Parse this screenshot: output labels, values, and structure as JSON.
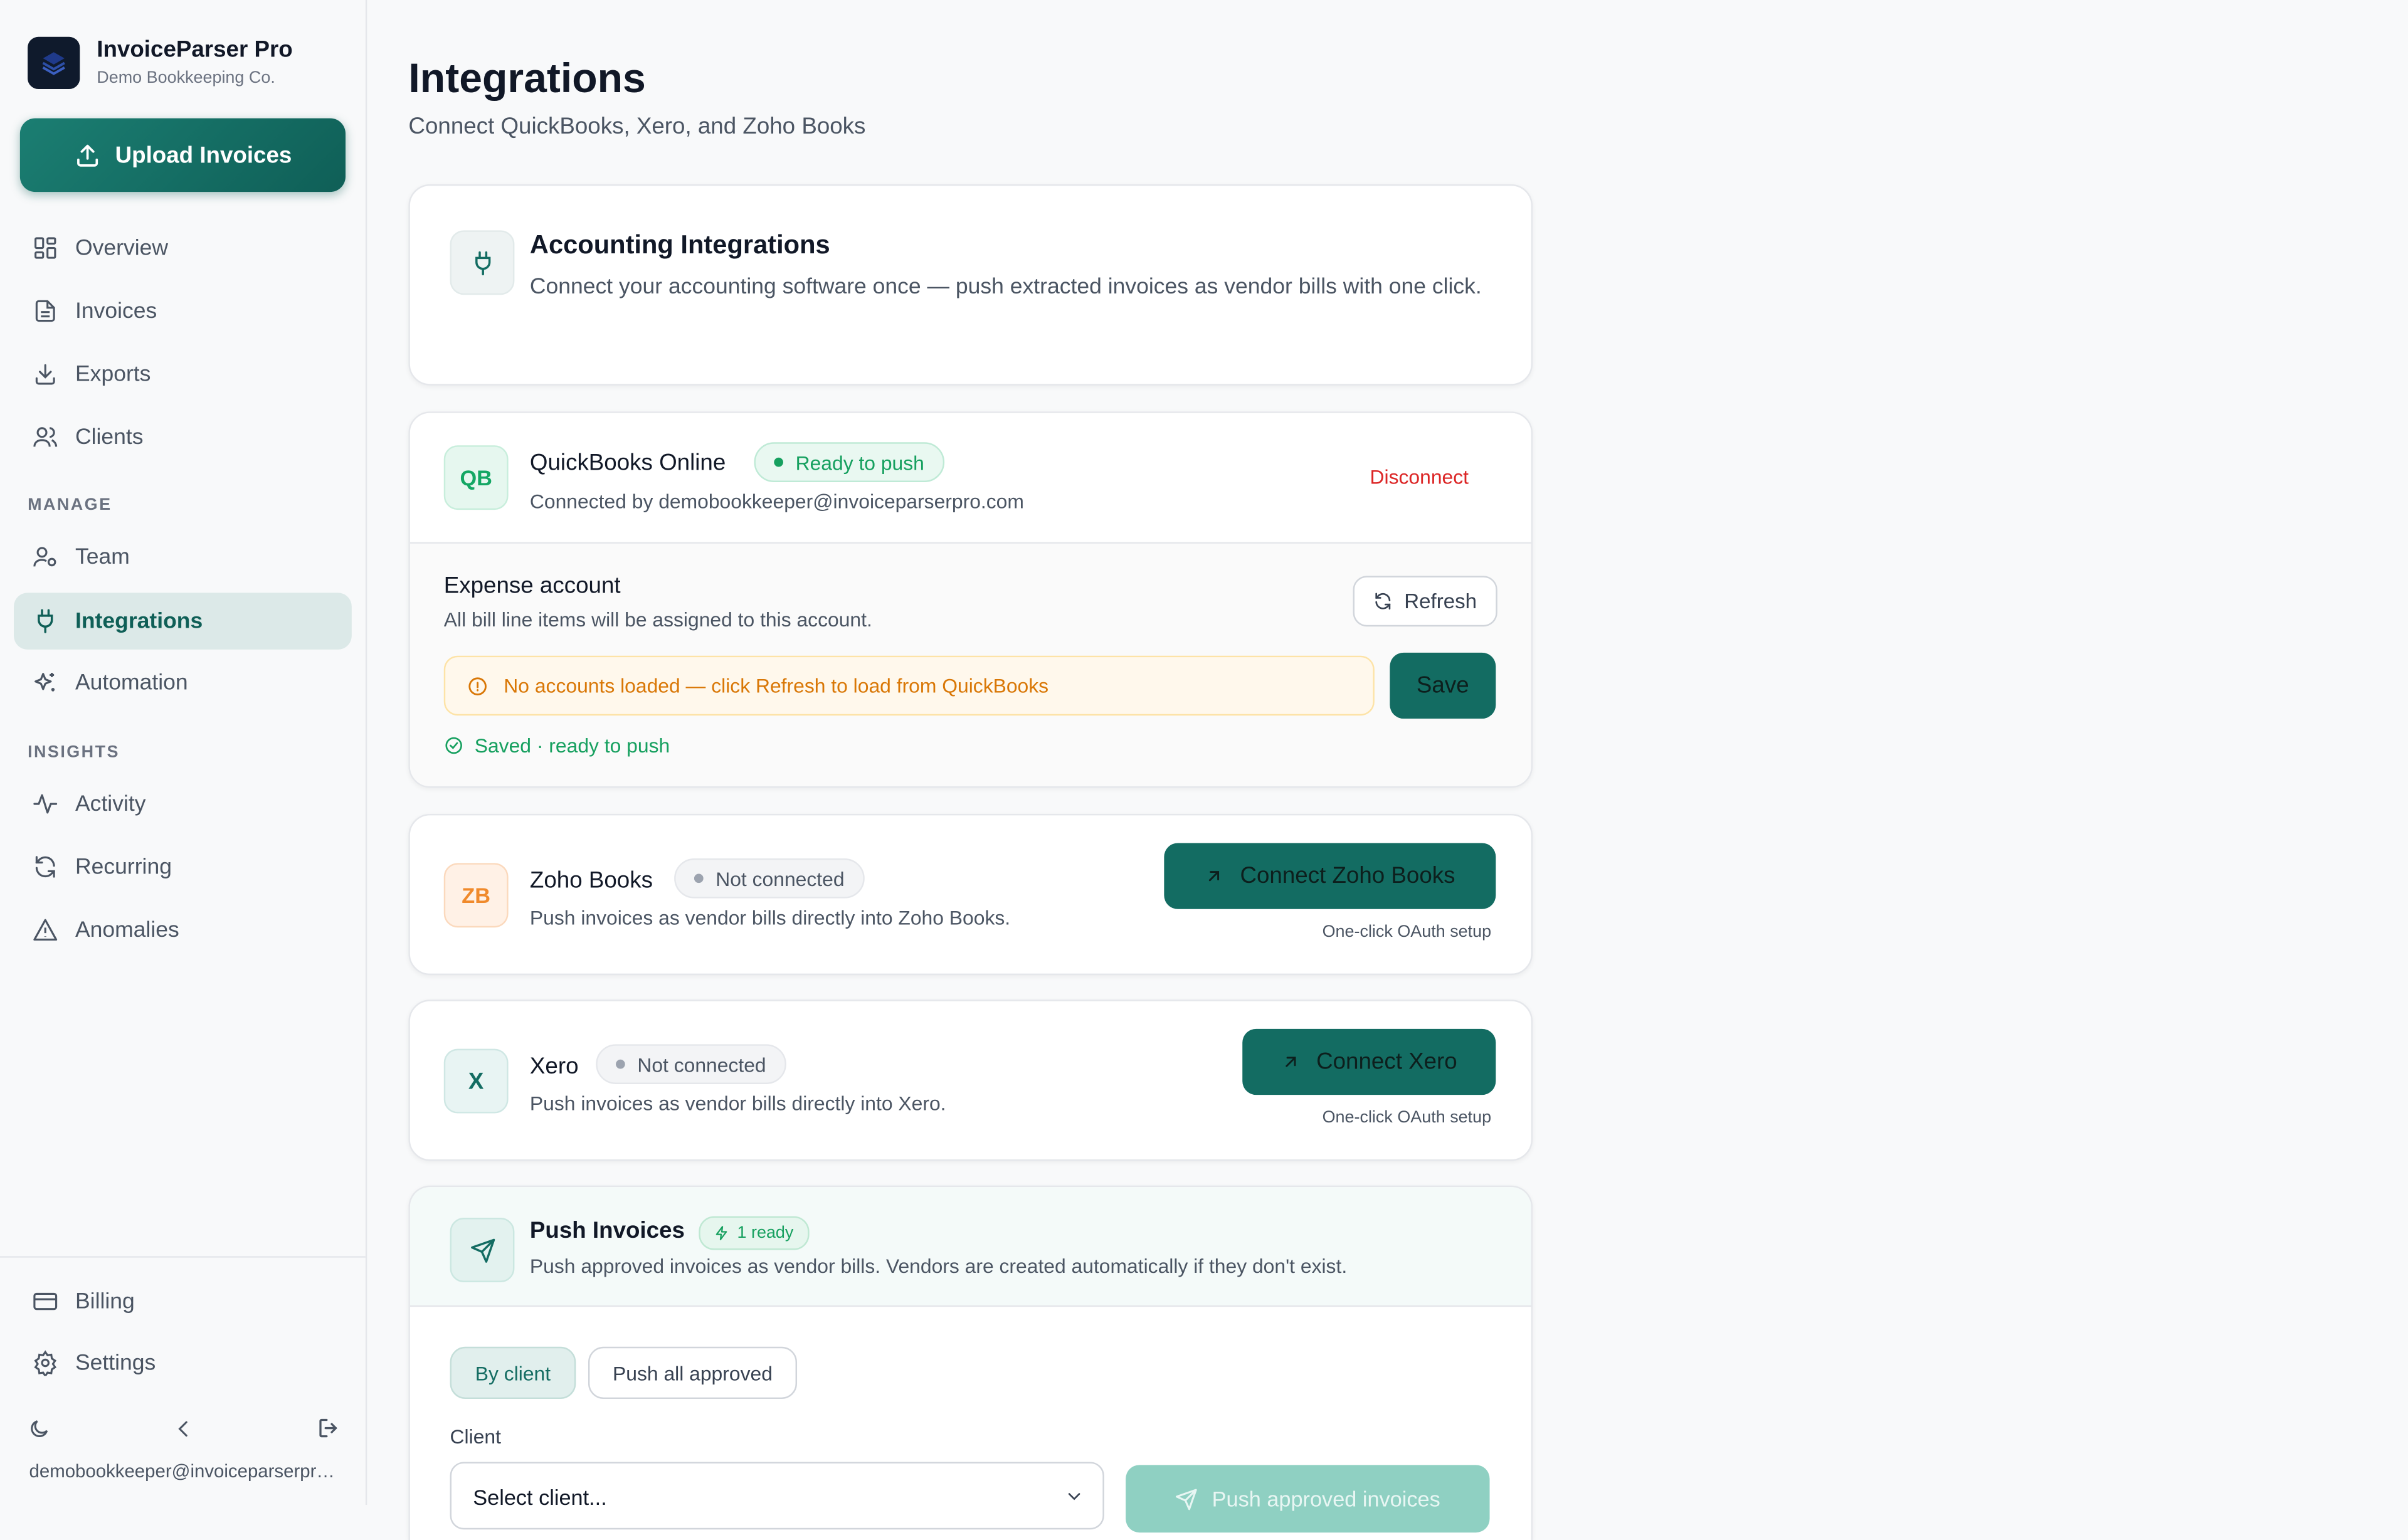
{
  "brand": {
    "name": "InvoiceParser Pro",
    "org": "Demo Bookkeeping Co."
  },
  "upload": {
    "label": "Upload Invoices"
  },
  "nav": {
    "main": [
      {
        "label": "Overview",
        "icon": "grid-icon"
      },
      {
        "label": "Invoices",
        "icon": "document-icon"
      },
      {
        "label": "Exports",
        "icon": "download-icon"
      },
      {
        "label": "Clients",
        "icon": "users-icon"
      }
    ],
    "manage_heading": "MANAGE",
    "manage": [
      {
        "label": "Team",
        "icon": "team-icon"
      },
      {
        "label": "Integrations",
        "icon": "plug-icon",
        "active": true
      },
      {
        "label": "Automation",
        "icon": "sparkles-icon"
      }
    ],
    "insights_heading": "INSIGHTS",
    "insights": [
      {
        "label": "Activity",
        "icon": "activity-icon"
      },
      {
        "label": "Recurring",
        "icon": "refresh-icon"
      },
      {
        "label": "Anomalies",
        "icon": "warning-icon"
      }
    ],
    "bottom": [
      {
        "label": "Billing",
        "icon": "credit-card-icon"
      },
      {
        "label": "Settings",
        "icon": "gear-icon"
      }
    ]
  },
  "user": {
    "email": "demobookkeeper@invoiceparserpro.com"
  },
  "page": {
    "title": "Integrations",
    "subtitle": "Connect QuickBooks, Xero, and Zoho Books"
  },
  "intro": {
    "title": "Accounting Integrations",
    "desc": "Connect your accounting software once — push extracted invoices as vendor bills with one click."
  },
  "quickbooks": {
    "abbr": "QB",
    "name": "QuickBooks Online",
    "status": "Ready to push",
    "connected_by": "Connected by demobookkeeper@invoiceparserpro.com",
    "disconnect": "Disconnect",
    "expense_title": "Expense account",
    "expense_desc": "All bill line items will be assigned to this account.",
    "refresh": "Refresh",
    "warning": "No accounts loaded — click Refresh to load from QuickBooks",
    "save": "Save",
    "saved": "Saved · ready to push"
  },
  "zoho": {
    "abbr": "ZB",
    "name": "Zoho Books",
    "status": "Not connected",
    "desc": "Push invoices as vendor bills directly into Zoho Books.",
    "button": "Connect Zoho Books",
    "note": "One-click OAuth setup"
  },
  "xero": {
    "abbr": "X",
    "name": "Xero",
    "status": "Not connected",
    "desc": "Push invoices as vendor bills directly into Xero.",
    "button": "Connect Xero",
    "note": "One-click OAuth setup"
  },
  "push": {
    "title": "Push Invoices",
    "badge": "1 ready",
    "desc": "Push approved invoices as vendor bills. Vendors are created automatically if they don't exist.",
    "tab_by_client": "By client",
    "tab_all": "Push all approved",
    "client_label": "Client",
    "client_placeholder": "Select client...",
    "button": "Push approved invoices"
  },
  "colors": {
    "accent": "#136c62",
    "success": "#10b981",
    "danger": "#dc2626",
    "warning": "#d97706"
  }
}
